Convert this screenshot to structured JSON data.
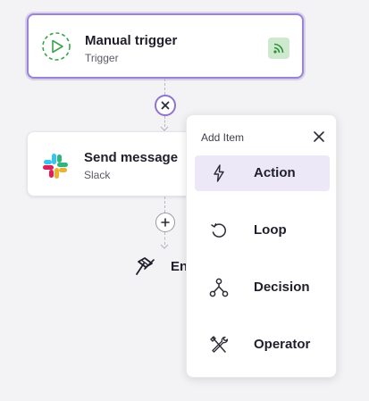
{
  "trigger_node": {
    "title": "Manual trigger",
    "subtitle": "Trigger",
    "icon": "play-circle-icon",
    "badge_icon": "rss-feed-icon",
    "accent": "#9b84d8",
    "badge_color": "#cfe9cf"
  },
  "slack_node": {
    "title": "Send message",
    "subtitle": "Slack",
    "icon": "slack-icon"
  },
  "flow": {
    "end_label": "End",
    "end_icon": "flag-icon",
    "remove_icon": "close-icon",
    "add_icon": "plus-icon"
  },
  "add_item_panel": {
    "title": "Add Item",
    "close_icon": "close-icon",
    "items": [
      {
        "label": "Action",
        "icon": "lightning-icon",
        "selected": true
      },
      {
        "label": "Loop",
        "icon": "loop-icon",
        "selected": false
      },
      {
        "label": "Decision",
        "icon": "decision-icon",
        "selected": false
      },
      {
        "label": "Operator",
        "icon": "tools-icon",
        "selected": false
      }
    ],
    "selected_color": "#ece8f7"
  }
}
